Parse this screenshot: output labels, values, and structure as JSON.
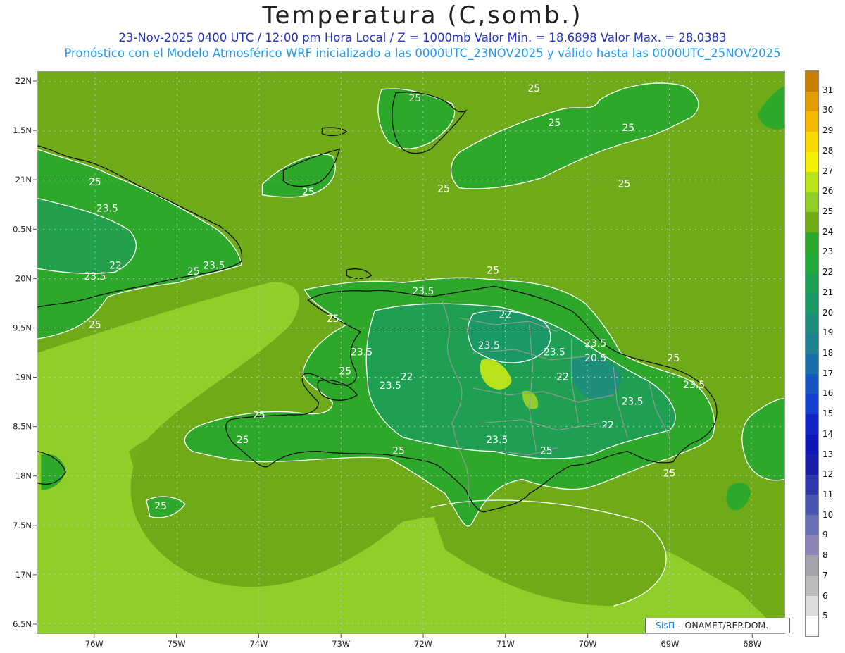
{
  "header": {
    "title": "Temperatura (C,somb.)",
    "line1": "23-Nov-2025 0400 UTC / 12:00 pm Hora Local / Z = 1000mb   Valor Min. = 18.6898   Valor Max. = 28.0383",
    "line2": "Pronóstico con el Modelo Atmosférico WRF inicializado a las 0000UTC_23NOV2025 y válido hasta las  0000UTC_25NOV2025"
  },
  "map": {
    "lon_range": [
      -76.7,
      -67.6
    ],
    "lat_range": [
      16.4,
      22.1
    ],
    "lon_ticks": [
      -76,
      -75,
      -74,
      -73,
      -72,
      -71,
      -70,
      -69,
      -68
    ],
    "lon_tick_labels": [
      "76W",
      "75W",
      "74W",
      "73W",
      "72W",
      "71W",
      "70W",
      "69W",
      "68W"
    ],
    "lat_ticks": [
      22,
      21.5,
      21,
      20.5,
      20,
      19.5,
      19,
      18.5,
      18,
      17.5,
      17,
      16.5
    ],
    "lat_tick_labels": [
      "22N",
      "1.5N",
      "21N",
      "0.5N",
      "20N",
      "9.5N",
      "19N",
      "8.5N",
      "18N",
      "7.5N",
      "17N",
      "6.5N"
    ],
    "contour_labels": [
      {
        "text": "25",
        "lon": -72.1,
        "lat": 21.8
      },
      {
        "text": "25",
        "lon": -70.65,
        "lat": 21.9
      },
      {
        "text": "25",
        "lon": -70.4,
        "lat": 21.55
      },
      {
        "text": "25",
        "lon": -69.5,
        "lat": 21.5
      },
      {
        "text": "25",
        "lon": -71.75,
        "lat": 20.88
      },
      {
        "text": "25",
        "lon": -69.55,
        "lat": 20.93
      },
      {
        "text": "25",
        "lon": -73.4,
        "lat": 20.85
      },
      {
        "text": "25",
        "lon": -76.0,
        "lat": 20.95
      },
      {
        "text": "23.5",
        "lon": -75.85,
        "lat": 20.68
      },
      {
        "text": "22",
        "lon": -75.75,
        "lat": 20.1
      },
      {
        "text": "23.5",
        "lon": -76.0,
        "lat": 19.99
      },
      {
        "text": "25",
        "lon": -74.8,
        "lat": 20.04
      },
      {
        "text": "23.5",
        "lon": -74.55,
        "lat": 20.1
      },
      {
        "text": "25",
        "lon": -76.0,
        "lat": 19.5
      },
      {
        "text": "25",
        "lon": -71.15,
        "lat": 20.05
      },
      {
        "text": "23.5",
        "lon": -72.0,
        "lat": 19.84
      },
      {
        "text": "22",
        "lon": -71.0,
        "lat": 19.6
      },
      {
        "text": "25",
        "lon": -73.1,
        "lat": 19.56
      },
      {
        "text": "23.5",
        "lon": -71.2,
        "lat": 19.29
      },
      {
        "text": "23.5",
        "lon": -72.75,
        "lat": 19.22
      },
      {
        "text": "23.5",
        "lon": -70.4,
        "lat": 19.22
      },
      {
        "text": "23.5",
        "lon": -69.9,
        "lat": 19.31
      },
      {
        "text": "20.5",
        "lon": -69.9,
        "lat": 19.16
      },
      {
        "text": "25",
        "lon": -72.95,
        "lat": 19.03
      },
      {
        "text": "22",
        "lon": -72.2,
        "lat": 18.97
      },
      {
        "text": "22",
        "lon": -70.3,
        "lat": 18.97
      },
      {
        "text": "25",
        "lon": -68.95,
        "lat": 19.16
      },
      {
        "text": "23.5",
        "lon": -72.4,
        "lat": 18.88
      },
      {
        "text": "23.5",
        "lon": -68.7,
        "lat": 18.89
      },
      {
        "text": "23.5",
        "lon": -69.45,
        "lat": 18.72
      },
      {
        "text": "22",
        "lon": -69.75,
        "lat": 18.48
      },
      {
        "text": "25",
        "lon": -74.0,
        "lat": 18.58
      },
      {
        "text": "25",
        "lon": -74.2,
        "lat": 18.33
      },
      {
        "text": "23.5",
        "lon": -71.1,
        "lat": 18.33
      },
      {
        "text": "25",
        "lon": -72.3,
        "lat": 18.22
      },
      {
        "text": "25",
        "lon": -70.5,
        "lat": 18.22
      },
      {
        "text": "25",
        "lon": -69.0,
        "lat": 17.99
      },
      {
        "text": "25",
        "lon": -75.2,
        "lat": 17.66
      }
    ]
  },
  "colorbar": {
    "labels": [
      "31",
      "30",
      "29",
      "28",
      "27",
      "26",
      "25",
      "24",
      "23",
      "22",
      "21",
      "20",
      "19",
      "18",
      "17",
      "16",
      "15",
      "14",
      "13",
      "12",
      "11",
      "10",
      "9",
      "8",
      "7",
      "6",
      "5"
    ],
    "colors": [
      "#c57e00",
      "#e49b00",
      "#f4b800",
      "#f8d900",
      "#f2f200",
      "#b9e21a",
      "#90cf2a",
      "#6faa18",
      "#2da82a",
      "#23a83a",
      "#1f9f52",
      "#1a9866",
      "#1d8f7b",
      "#1f8290",
      "#1a6fa8",
      "#1656be",
      "#1440cc",
      "#1327c6",
      "#0e19b4",
      "#1a1fa6",
      "#2e38a8",
      "#4856b0",
      "#6a70b6",
      "#8a84b6",
      "#a2a2a8",
      "#bcbcbc",
      "#dcdcdc",
      "#ffffff"
    ]
  },
  "credit": {
    "brand": "SisΠ",
    "text": "– ONAMET/REP.DOM."
  }
}
